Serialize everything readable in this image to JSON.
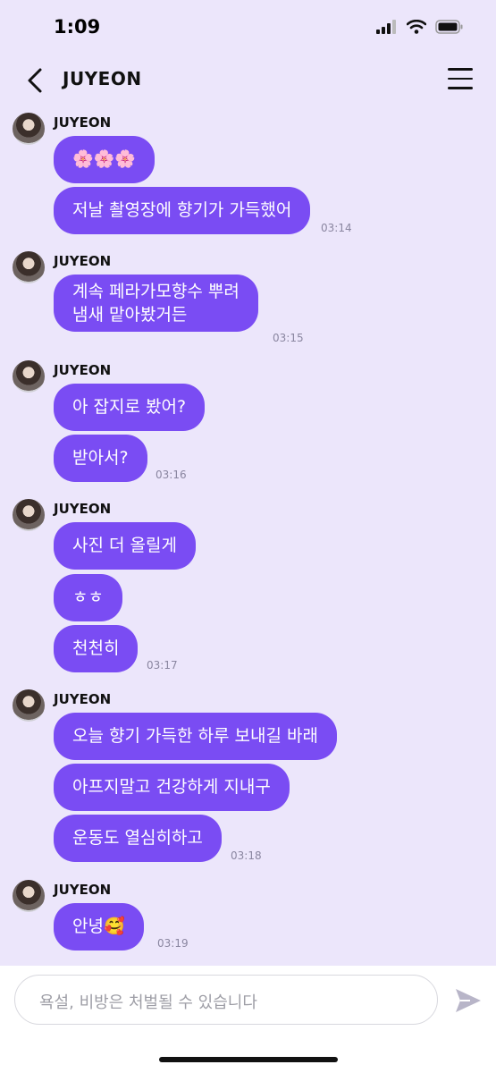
{
  "status_bar": {
    "time": "1:09"
  },
  "header": {
    "title": "JUYEON"
  },
  "messages": [
    {
      "sender": "JUYEON",
      "bubbles": [
        "🌸🌸🌸",
        "저날 촬영장에 향기가 가득했어"
      ],
      "time": "03:14"
    },
    {
      "sender": "JUYEON",
      "bubbles": [
        "계속 페라가모향수 뿌려\n냄새 맡아봤거든"
      ],
      "time": "03:15"
    },
    {
      "sender": "JUYEON",
      "bubbles": [
        "아 잡지로 봤어?",
        "받아서?"
      ],
      "time": "03:16"
    },
    {
      "sender": "JUYEON",
      "bubbles": [
        "사진 더 올릴게",
        "ㅎㅎ",
        "천천히"
      ],
      "time": "03:17"
    },
    {
      "sender": "JUYEON",
      "bubbles": [
        "오늘 향기 가득한 하루 보내길 바래",
        "아프지말고 건강하게 지내구",
        "운동도 열심히하고"
      ],
      "time": "03:18"
    },
    {
      "sender": "JUYEON",
      "bubbles": [
        "안녕🥰"
      ],
      "time": "03:19"
    }
  ],
  "composer": {
    "placeholder": "욕설, 비방은 처벌될 수 있습니다"
  },
  "colors": {
    "bubble": "#7a4cf3",
    "background": "#ece6fb",
    "send": "#b8b5c8"
  }
}
